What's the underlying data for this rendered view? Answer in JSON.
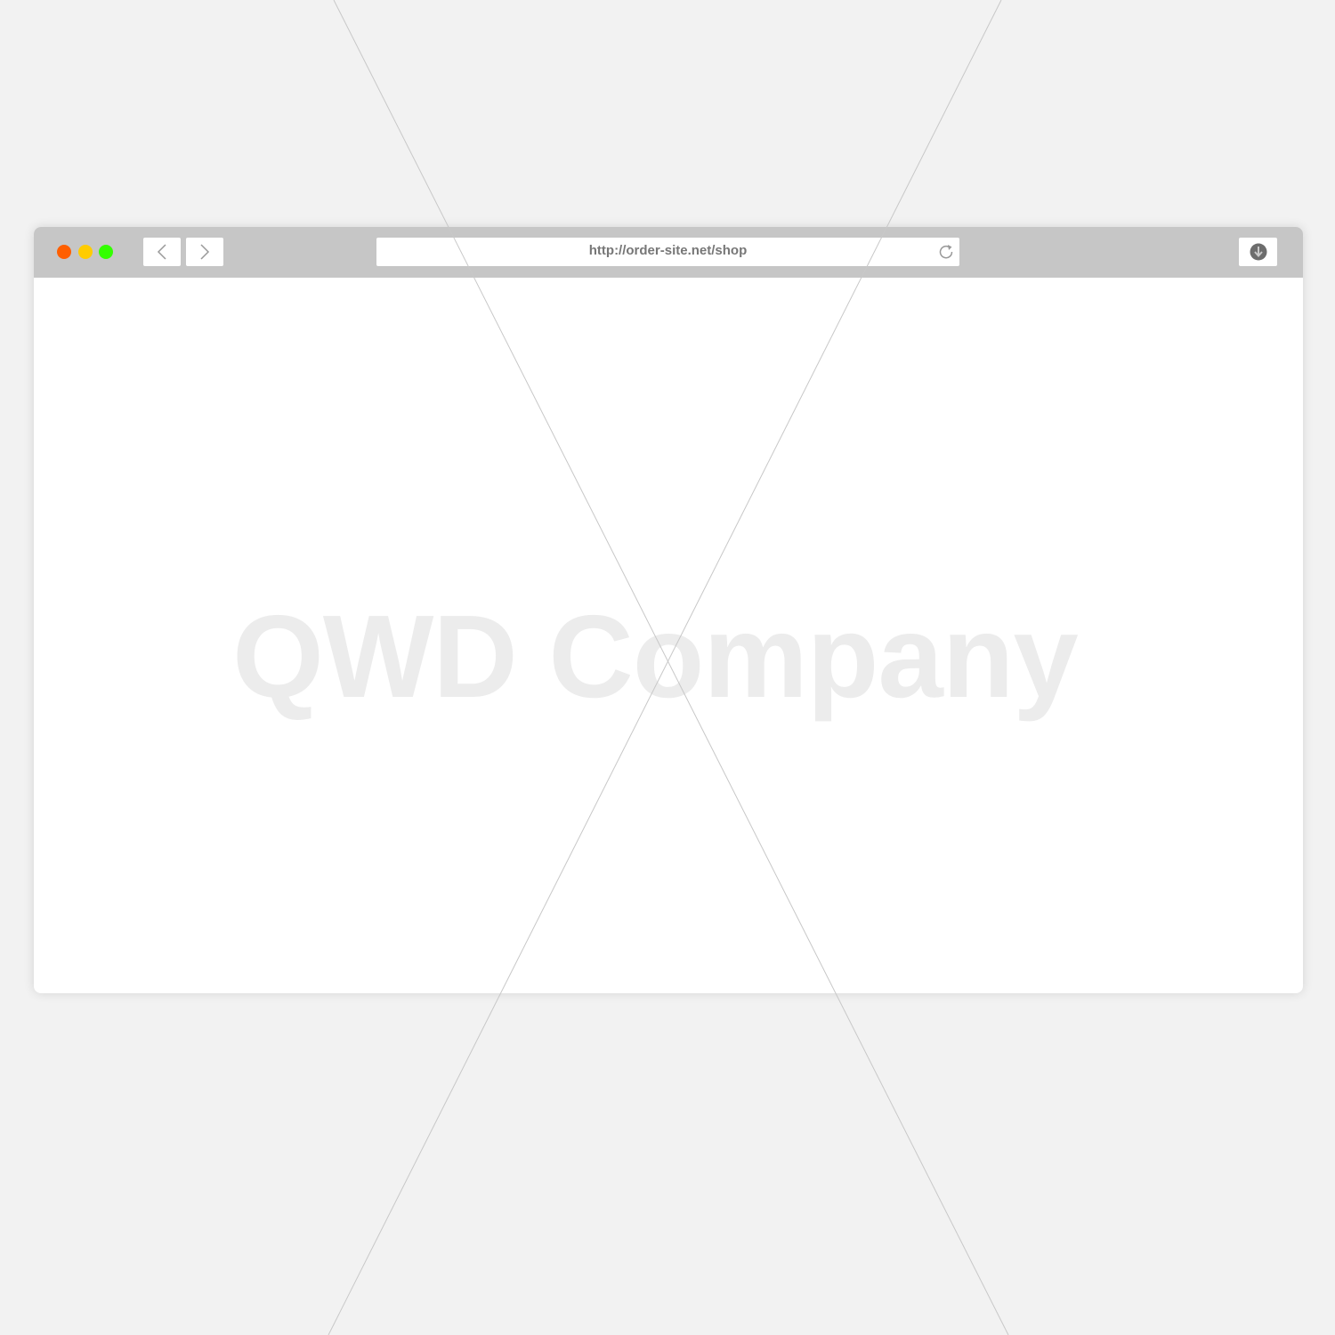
{
  "browser": {
    "window_controls": {
      "close_color": "#ff5f00",
      "minimize_color": "#ffcc00",
      "maximize_color": "#33ff00"
    },
    "back_icon": "chevron-left-icon",
    "forward_icon": "chevron-right-icon",
    "address_bar": {
      "url": "http://order-site.net/shop"
    },
    "reload_icon": "reload-icon",
    "download_icon": "download-icon"
  },
  "content": {
    "watermark": "QWD Company"
  }
}
